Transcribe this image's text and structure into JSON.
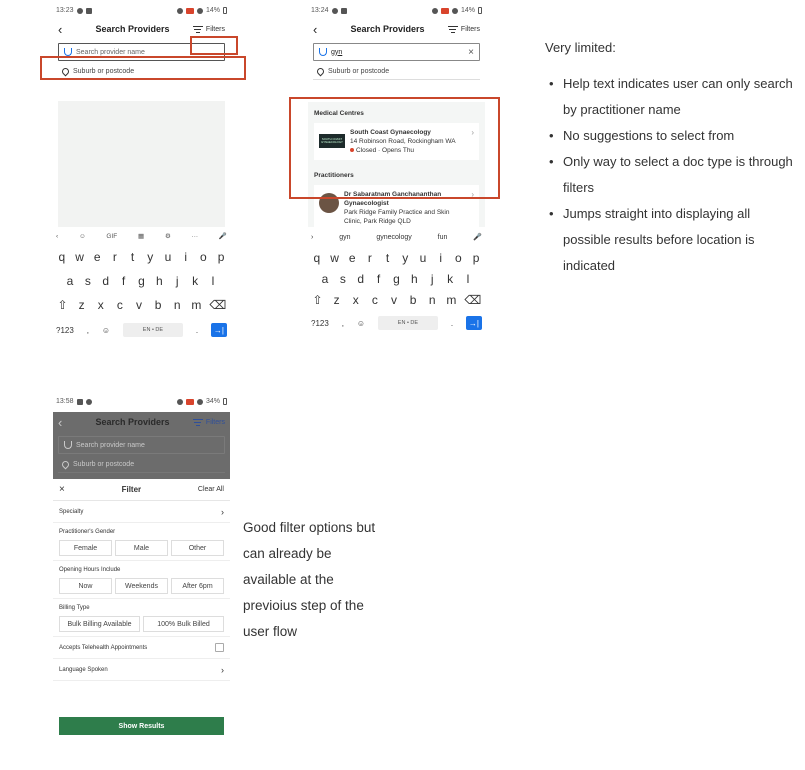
{
  "colors": {
    "accent_blue": "#1a73e8",
    "highlight_red": "#c9472b",
    "green_button": "#2e7d4b",
    "panel_grey": "#f2f3f2"
  },
  "phone1": {
    "status": {
      "time": "13:23",
      "battery": "14%"
    },
    "appbar": {
      "back": "‹",
      "title": "Search Providers",
      "filters": "Filters"
    },
    "search": {
      "placeholder": "Search provider name",
      "suburb": "Suburb or postcode"
    },
    "keyboard": {
      "tools": [
        "‹",
        "☺",
        "GIF",
        "▦",
        "⚙",
        "···",
        "🎤"
      ],
      "row1": [
        "q",
        "w",
        "e",
        "r",
        "t",
        "y",
        "u",
        "i",
        "o",
        "p"
      ],
      "row2": [
        "a",
        "s",
        "d",
        "f",
        "g",
        "h",
        "j",
        "k",
        "l"
      ],
      "row3": [
        "⇧",
        "z",
        "x",
        "c",
        "v",
        "b",
        "n",
        "m",
        "⌫"
      ],
      "sym": "?123",
      "comma": ",",
      "emoji": "☺",
      "space": "EN • DE",
      "period": ".",
      "enter": "→|"
    }
  },
  "phone2": {
    "status": {
      "time": "13:24",
      "battery": "14%"
    },
    "appbar": {
      "back": "‹",
      "title": "Search Providers",
      "filters": "Filters"
    },
    "search": {
      "value": "gyn",
      "clear": "×",
      "suburb": "Suburb or postcode"
    },
    "medical_centres": {
      "heading": "Medical Centres",
      "logo_text": "SOUTH COAST GYNAECOLOGY",
      "name": "South Coast Gynaecology",
      "address": "14 Robinson Road, Rockingham WA",
      "status": "Closed · Opens Thu"
    },
    "practitioners": {
      "heading": "Practitioners",
      "name": "Dr Sabaratnam Ganchananthan",
      "role": "Gynaecologist",
      "practice": "Park Ridge Family Practice and Skin",
      "extra": "Clinic, Park Ridge QLD"
    },
    "suggestions": [
      "›",
      "gyn",
      "gynecology",
      "fun",
      "🎤"
    ],
    "keyboard": {
      "row1": [
        "q",
        "w",
        "e",
        "r",
        "t",
        "y",
        "u",
        "i",
        "o",
        "p"
      ],
      "row2": [
        "a",
        "s",
        "d",
        "f",
        "g",
        "h",
        "j",
        "k",
        "l"
      ],
      "row3": [
        "⇧",
        "z",
        "x",
        "c",
        "v",
        "b",
        "n",
        "m",
        "⌫"
      ],
      "sym": "?123",
      "comma": ",",
      "emoji": "☺",
      "space": "EN • DE",
      "period": ".",
      "enter": "→|"
    }
  },
  "phone3": {
    "status": {
      "time": "13:58",
      "battery": "34%"
    },
    "appbar": {
      "back": "‹",
      "title": "Search Providers",
      "filters": "Filters"
    },
    "search": {
      "placeholder": "Search provider name",
      "suburb": "Suburb or postcode"
    },
    "filter": {
      "close": "×",
      "title": "Filter",
      "clear_all": "Clear All",
      "specialty": "Specialty",
      "gender_label": "Practitioner's Gender",
      "gender_options": [
        "Female",
        "Male",
        "Other"
      ],
      "hours_label": "Opening Hours Include",
      "hours_options": [
        "Now",
        "Weekends",
        "After 6pm"
      ],
      "billing_label": "Billing Type",
      "billing_options": [
        "Bulk Billing Available",
        "100% Bulk Billed"
      ],
      "telehealth": "Accepts Telehealth Appointments",
      "language": "Language Spoken",
      "show_results": "Show Results",
      "chevron": "›"
    }
  },
  "notes": {
    "title": "Very limited:",
    "items": [
      "Help text indicates user can only search by practitioner name",
      "No suggestions to select from",
      "Only way to select a doc type is through filters",
      "Jumps straight into displaying all possible results before location is indicated"
    ]
  },
  "note2": "Good filter options but can already be available at the previoius step of the user flow"
}
